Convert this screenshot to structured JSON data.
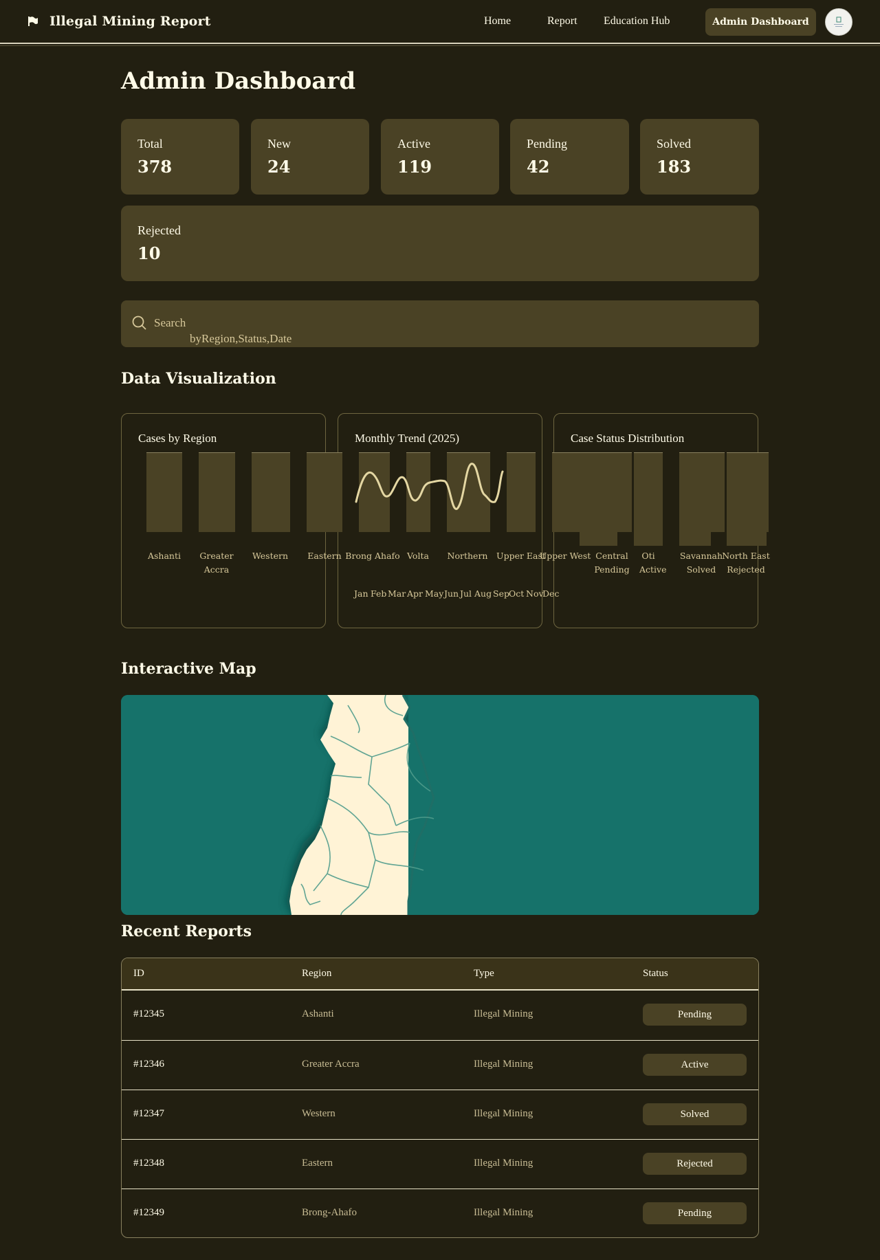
{
  "nav": {
    "brand": "Illegal Mining Report",
    "links": [
      "Home",
      "Report",
      "Education Hub"
    ],
    "cta": "Admin Dashboard"
  },
  "page": {
    "title": "Admin Dashboard"
  },
  "stats": [
    {
      "label": "Total",
      "value": "378"
    },
    {
      "label": "New",
      "value": "24"
    },
    {
      "label": "Active",
      "value": "119"
    },
    {
      "label": "Pending",
      "value": "42"
    },
    {
      "label": "Solved",
      "value": "183"
    },
    {
      "label": "Rejected",
      "value": "10"
    }
  ],
  "search": {
    "placeholder": "Search",
    "hint": "byRegion,Status,Date"
  },
  "sections": {
    "viz": "Data Visualization",
    "map": "Interactive Map",
    "reports": "Recent Reports"
  },
  "chart_data": [
    {
      "type": "bar",
      "title": "Cases by Region",
      "categories": [
        "Ashanti",
        "Greater Accra",
        "Western",
        "Eastern",
        "Brong Ahafo",
        "Volta",
        "Northern",
        "Upper East",
        "Upper West"
      ],
      "values": [
        100,
        100,
        100,
        100,
        100,
        100,
        100,
        100,
        100
      ]
    },
    {
      "type": "line",
      "title": "Monthly Trend (2025)",
      "categories": [
        "Jan",
        "Feb",
        "Mar",
        "Apr",
        "May",
        "Jun",
        "Jul",
        "Aug",
        "Sep",
        "Oct",
        "Nov",
        "Dec"
      ]
    },
    {
      "type": "bar",
      "title": "Case Status Distribution",
      "categories": [
        "Central Pending",
        "Oti Active",
        "Savannah Solved",
        "North East Rejected"
      ]
    }
  ],
  "table": {
    "headers": [
      "ID",
      "Region",
      "Type",
      "Status"
    ],
    "rows": [
      {
        "id": "#12345",
        "region": "Ashanti",
        "type": "Illegal Mining",
        "status": "Pending"
      },
      {
        "id": "#12346",
        "region": "Greater Accra",
        "type": "Illegal Mining",
        "status": "Active"
      },
      {
        "id": "#12347",
        "region": "Western",
        "type": "Illegal Mining",
        "status": "Solved"
      },
      {
        "id": "#12348",
        "region": "Eastern",
        "type": "Illegal Mining",
        "status": "Rejected"
      },
      {
        "id": "#12349",
        "region": "Brong-Ahafo",
        "type": "Illegal Mining",
        "status": "Pending"
      }
    ]
  },
  "icons": {
    "brand": "flag-icon",
    "search": "search-icon",
    "avatar": "avatar-logo"
  },
  "colors": {
    "background": "#221f11",
    "card": "#4a4225",
    "accent": "#e4d7a3",
    "map_sea": "#16726a",
    "map_land": "#fff3d6"
  }
}
